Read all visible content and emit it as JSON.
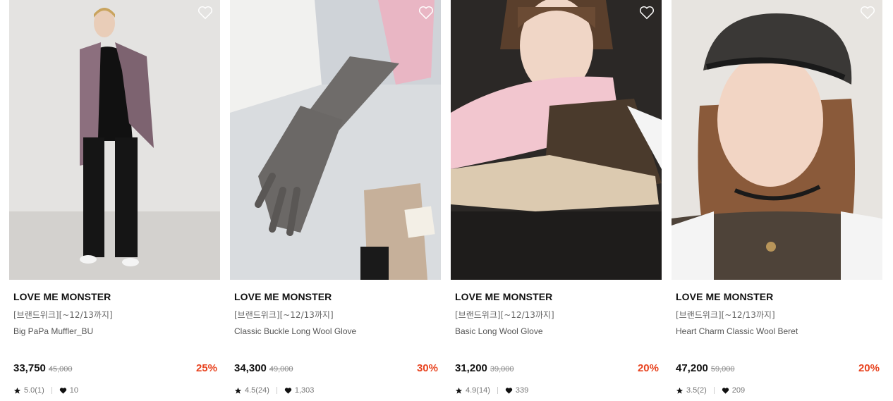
{
  "products": [
    {
      "brand": "LOVE ME MONSTER",
      "promo": "[브랜드위크][~12/13까지]",
      "name": "Big PaPa Muffler_BU",
      "price": "33,750",
      "original_price": "45,000",
      "discount": "25%",
      "rating": "5.0(1)",
      "likes": "10"
    },
    {
      "brand": "LOVE ME MONSTER",
      "promo": "[브랜드위크][~12/13까지]",
      "name": "Classic Buckle Long Wool Glove",
      "price": "34,300",
      "original_price": "49,000",
      "discount": "30%",
      "rating": "4.5(24)",
      "likes": "1,303"
    },
    {
      "brand": "LOVE ME MONSTER",
      "promo": "[브랜드위크][~12/13까지]",
      "name": "Basic Long Wool Glove",
      "price": "31,200",
      "original_price": "39,000",
      "discount": "20%",
      "rating": "4.9(14)",
      "likes": "339"
    },
    {
      "brand": "LOVE ME MONSTER",
      "promo": "[브랜드위크][~12/13까지]",
      "name": "Heart Charm Classic Wool Beret",
      "price": "47,200",
      "original_price": "59,000",
      "discount": "20%",
      "rating": "3.5(2)",
      "likes": "209"
    }
  ],
  "colors": {
    "discount": "#e8431f",
    "price": "#111111",
    "muted": "#777777"
  },
  "icons": {
    "wishlist": "heart-outline-icon",
    "rating": "star-icon",
    "likes": "heart-filled-icon"
  }
}
